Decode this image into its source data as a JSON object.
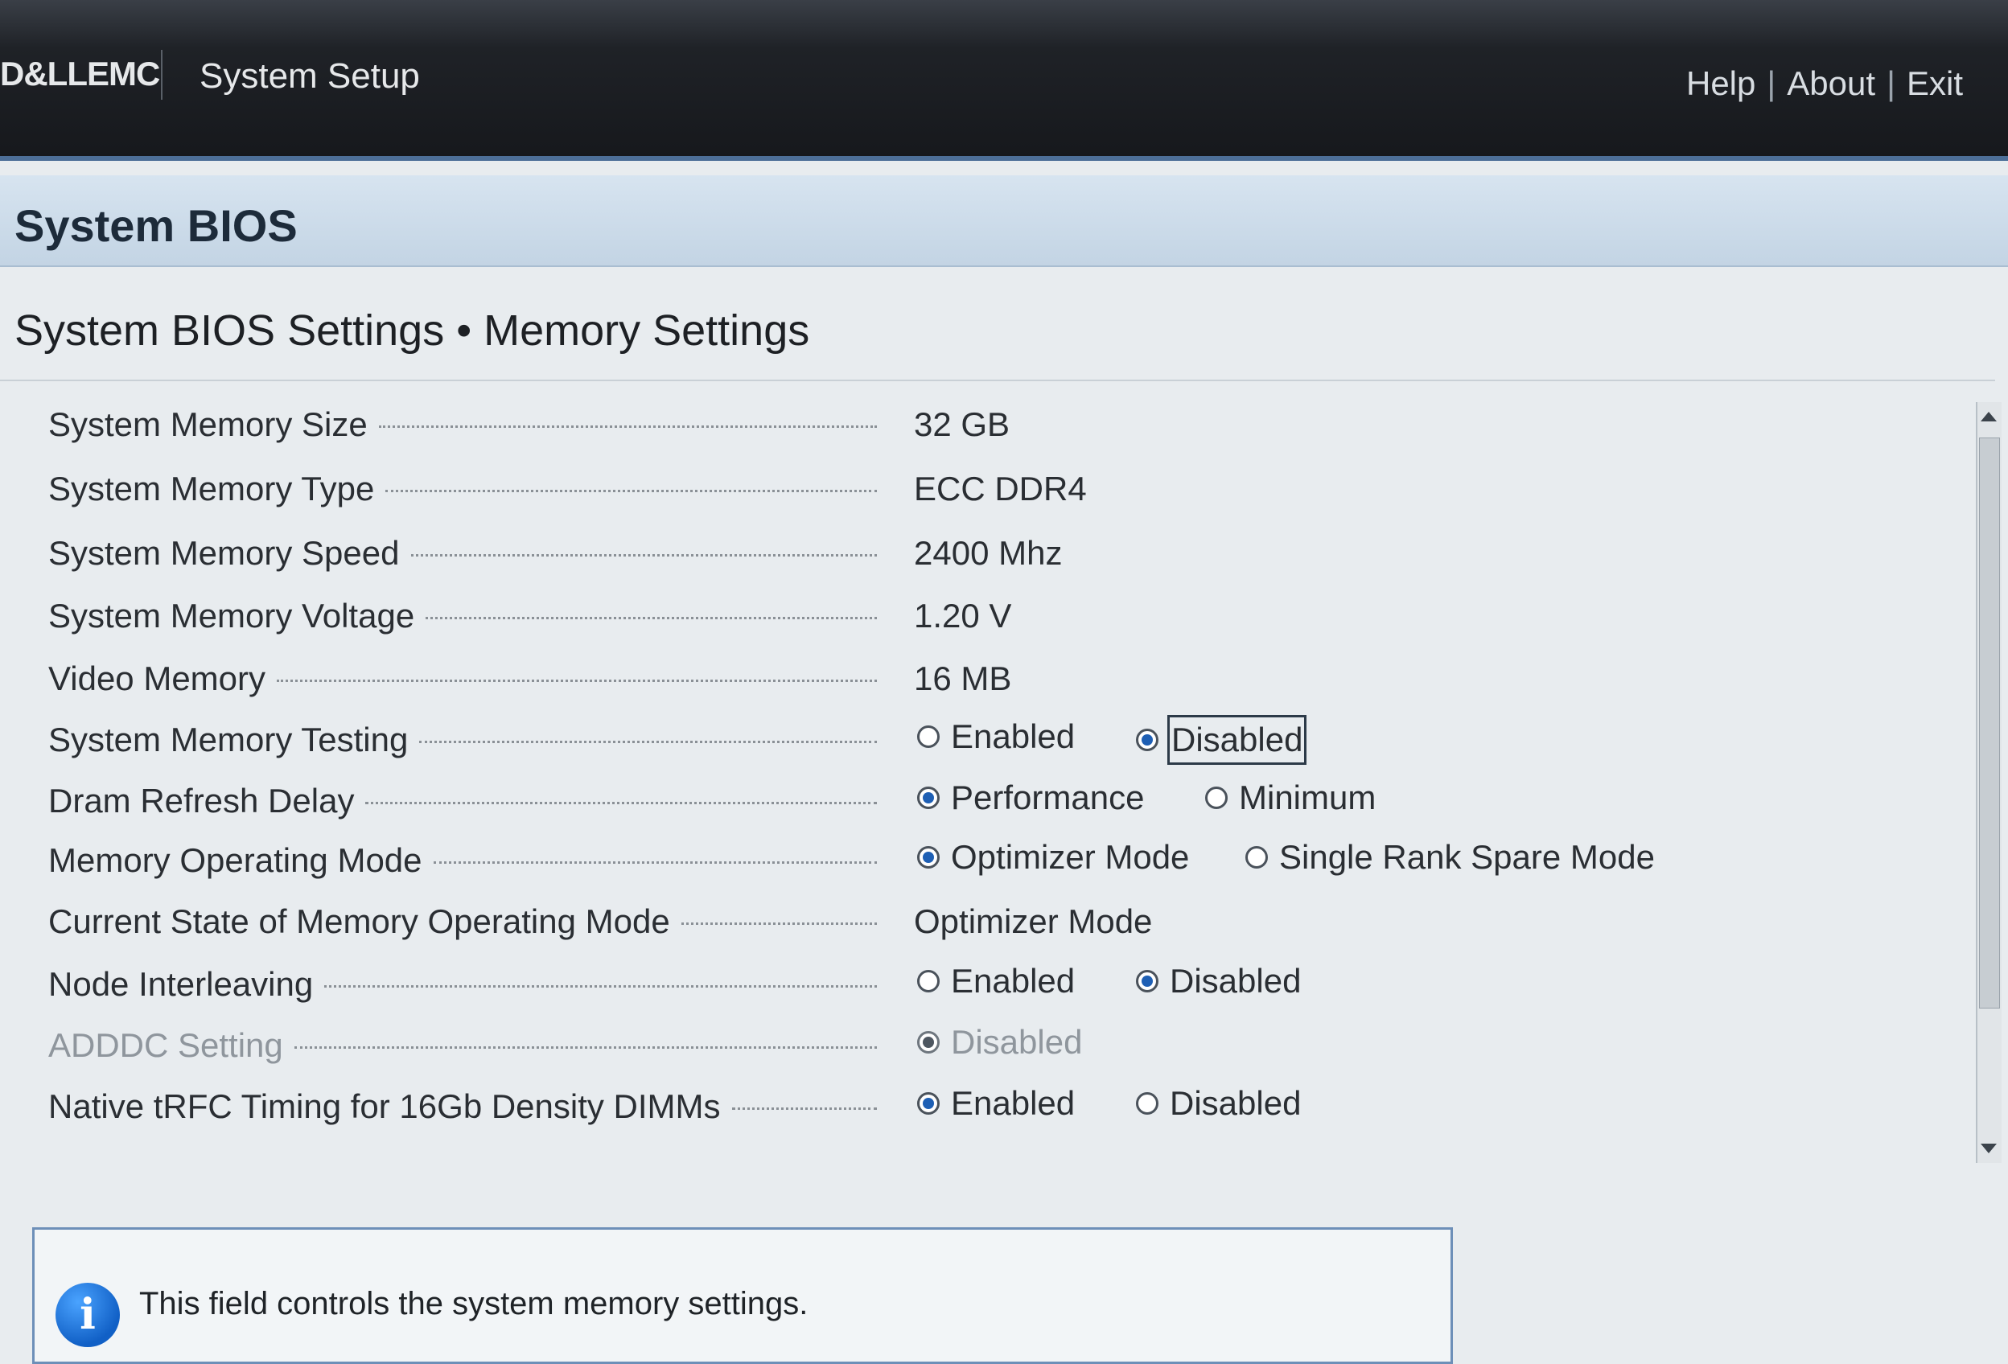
{
  "header": {
    "brand": "D&LLEMC",
    "app_title": "System Setup",
    "links": [
      "Help",
      "About",
      "Exit"
    ]
  },
  "section": {
    "title": "System BIOS",
    "breadcrumb": "System BIOS Settings • Memory Settings"
  },
  "settings": [
    {
      "label": "System Memory Size",
      "value": "32 GB"
    },
    {
      "label": "System Memory Type",
      "value": "ECC DDR4"
    },
    {
      "label": "System Memory Speed",
      "value": "2400 Mhz"
    },
    {
      "label": "System Memory Voltage",
      "value": "1.20 V"
    },
    {
      "label": "Video Memory",
      "value": "16 MB"
    },
    {
      "label": "System Memory Testing",
      "options": [
        "Enabled",
        "Disabled"
      ],
      "selected": "Disabled",
      "focused": "Disabled"
    },
    {
      "label": "Dram Refresh Delay",
      "options": [
        "Performance",
        "Minimum"
      ],
      "selected": "Performance"
    },
    {
      "label": "Memory Operating Mode",
      "options": [
        "Optimizer Mode",
        "Single Rank Spare Mode"
      ],
      "selected": "Optimizer Mode"
    },
    {
      "label": "Current State of Memory Operating Mode",
      "value": "Optimizer Mode"
    },
    {
      "label": "Node Interleaving",
      "options": [
        "Enabled",
        "Disabled"
      ],
      "selected": "Disabled"
    },
    {
      "label": "ADDDC Setting",
      "options": [
        "Disabled"
      ],
      "selected": "Disabled",
      "disabled": true
    },
    {
      "label": "Native tRFC Timing for 16Gb Density DIMMs",
      "options": [
        "Enabled",
        "Disabled"
      ],
      "selected": "Enabled"
    }
  ],
  "help": {
    "icon": "info-icon",
    "icon_glyph": "i",
    "text": "This field controls the system memory settings."
  },
  "colors": {
    "topbar": "#1f2227",
    "header_band": "#c3d4e4",
    "radio_selected": "#1e5fb4",
    "help_border": "#6d8fb8"
  }
}
